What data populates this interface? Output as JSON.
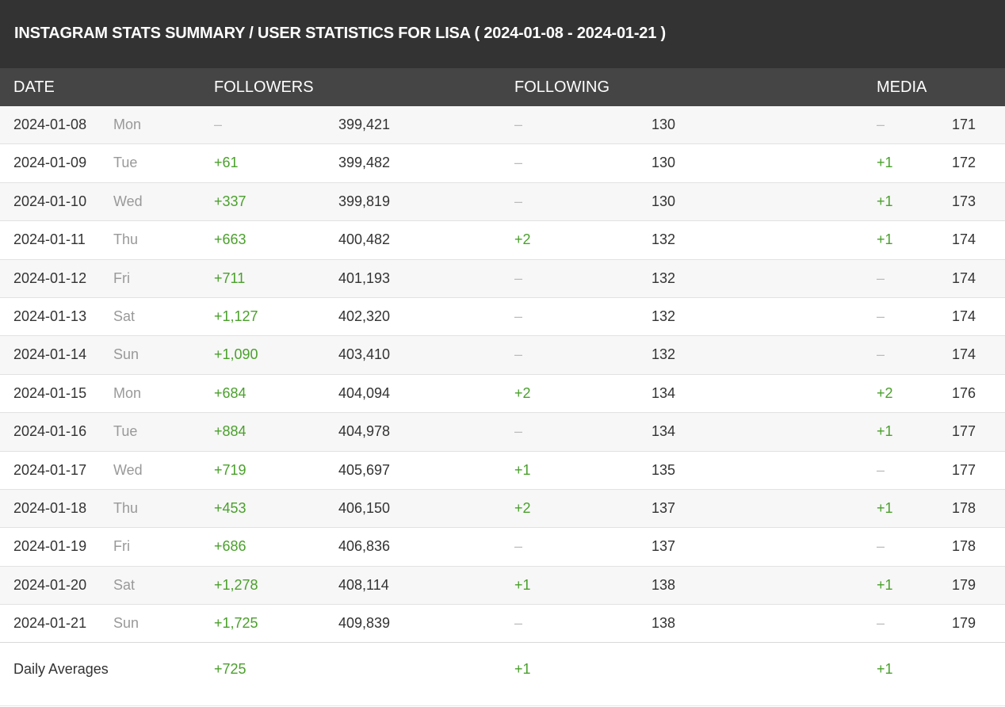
{
  "title": "INSTAGRAM STATS SUMMARY / USER STATISTICS FOR LISA ( 2024-01-08 - 2024-01-21 )",
  "columns": {
    "date": "DATE",
    "followers": "FOLLOWERS",
    "following": "FOLLOWING",
    "media": "MEDIA"
  },
  "rows": [
    {
      "date": "2024-01-08",
      "dow": "Mon",
      "f_delta": "–",
      "f_total": "399,421",
      "fo_delta": "–",
      "fo_total": "130",
      "m_delta": "–",
      "m_total": "171"
    },
    {
      "date": "2024-01-09",
      "dow": "Tue",
      "f_delta": "+61",
      "f_total": "399,482",
      "fo_delta": "–",
      "fo_total": "130",
      "m_delta": "+1",
      "m_total": "172"
    },
    {
      "date": "2024-01-10",
      "dow": "Wed",
      "f_delta": "+337",
      "f_total": "399,819",
      "fo_delta": "–",
      "fo_total": "130",
      "m_delta": "+1",
      "m_total": "173"
    },
    {
      "date": "2024-01-11",
      "dow": "Thu",
      "f_delta": "+663",
      "f_total": "400,482",
      "fo_delta": "+2",
      "fo_total": "132",
      "m_delta": "+1",
      "m_total": "174"
    },
    {
      "date": "2024-01-12",
      "dow": "Fri",
      "f_delta": "+711",
      "f_total": "401,193",
      "fo_delta": "–",
      "fo_total": "132",
      "m_delta": "–",
      "m_total": "174"
    },
    {
      "date": "2024-01-13",
      "dow": "Sat",
      "f_delta": "+1,127",
      "f_total": "402,320",
      "fo_delta": "–",
      "fo_total": "132",
      "m_delta": "–",
      "m_total": "174"
    },
    {
      "date": "2024-01-14",
      "dow": "Sun",
      "f_delta": "+1,090",
      "f_total": "403,410",
      "fo_delta": "–",
      "fo_total": "132",
      "m_delta": "–",
      "m_total": "174"
    },
    {
      "date": "2024-01-15",
      "dow": "Mon",
      "f_delta": "+684",
      "f_total": "404,094",
      "fo_delta": "+2",
      "fo_total": "134",
      "m_delta": "+2",
      "m_total": "176"
    },
    {
      "date": "2024-01-16",
      "dow": "Tue",
      "f_delta": "+884",
      "f_total": "404,978",
      "fo_delta": "–",
      "fo_total": "134",
      "m_delta": "+1",
      "m_total": "177"
    },
    {
      "date": "2024-01-17",
      "dow": "Wed",
      "f_delta": "+719",
      "f_total": "405,697",
      "fo_delta": "+1",
      "fo_total": "135",
      "m_delta": "–",
      "m_total": "177"
    },
    {
      "date": "2024-01-18",
      "dow": "Thu",
      "f_delta": "+453",
      "f_total": "406,150",
      "fo_delta": "+2",
      "fo_total": "137",
      "m_delta": "+1",
      "m_total": "178"
    },
    {
      "date": "2024-01-19",
      "dow": "Fri",
      "f_delta": "+686",
      "f_total": "406,836",
      "fo_delta": "–",
      "fo_total": "137",
      "m_delta": "–",
      "m_total": "178"
    },
    {
      "date": "2024-01-20",
      "dow": "Sat",
      "f_delta": "+1,278",
      "f_total": "408,114",
      "fo_delta": "+1",
      "fo_total": "138",
      "m_delta": "+1",
      "m_total": "179"
    },
    {
      "date": "2024-01-21",
      "dow": "Sun",
      "f_delta": "+1,725",
      "f_total": "409,839",
      "fo_delta": "–",
      "fo_total": "138",
      "m_delta": "–",
      "m_total": "179"
    }
  ],
  "averages": {
    "label": "Daily Averages",
    "followers": "+725",
    "following": "+1",
    "media": "+1"
  },
  "colors": {
    "title_bg": "#333333",
    "header_bg": "#454545",
    "positive": "#4aa02c",
    "no_change": "#bbbbbb",
    "weekday": "#999999"
  }
}
